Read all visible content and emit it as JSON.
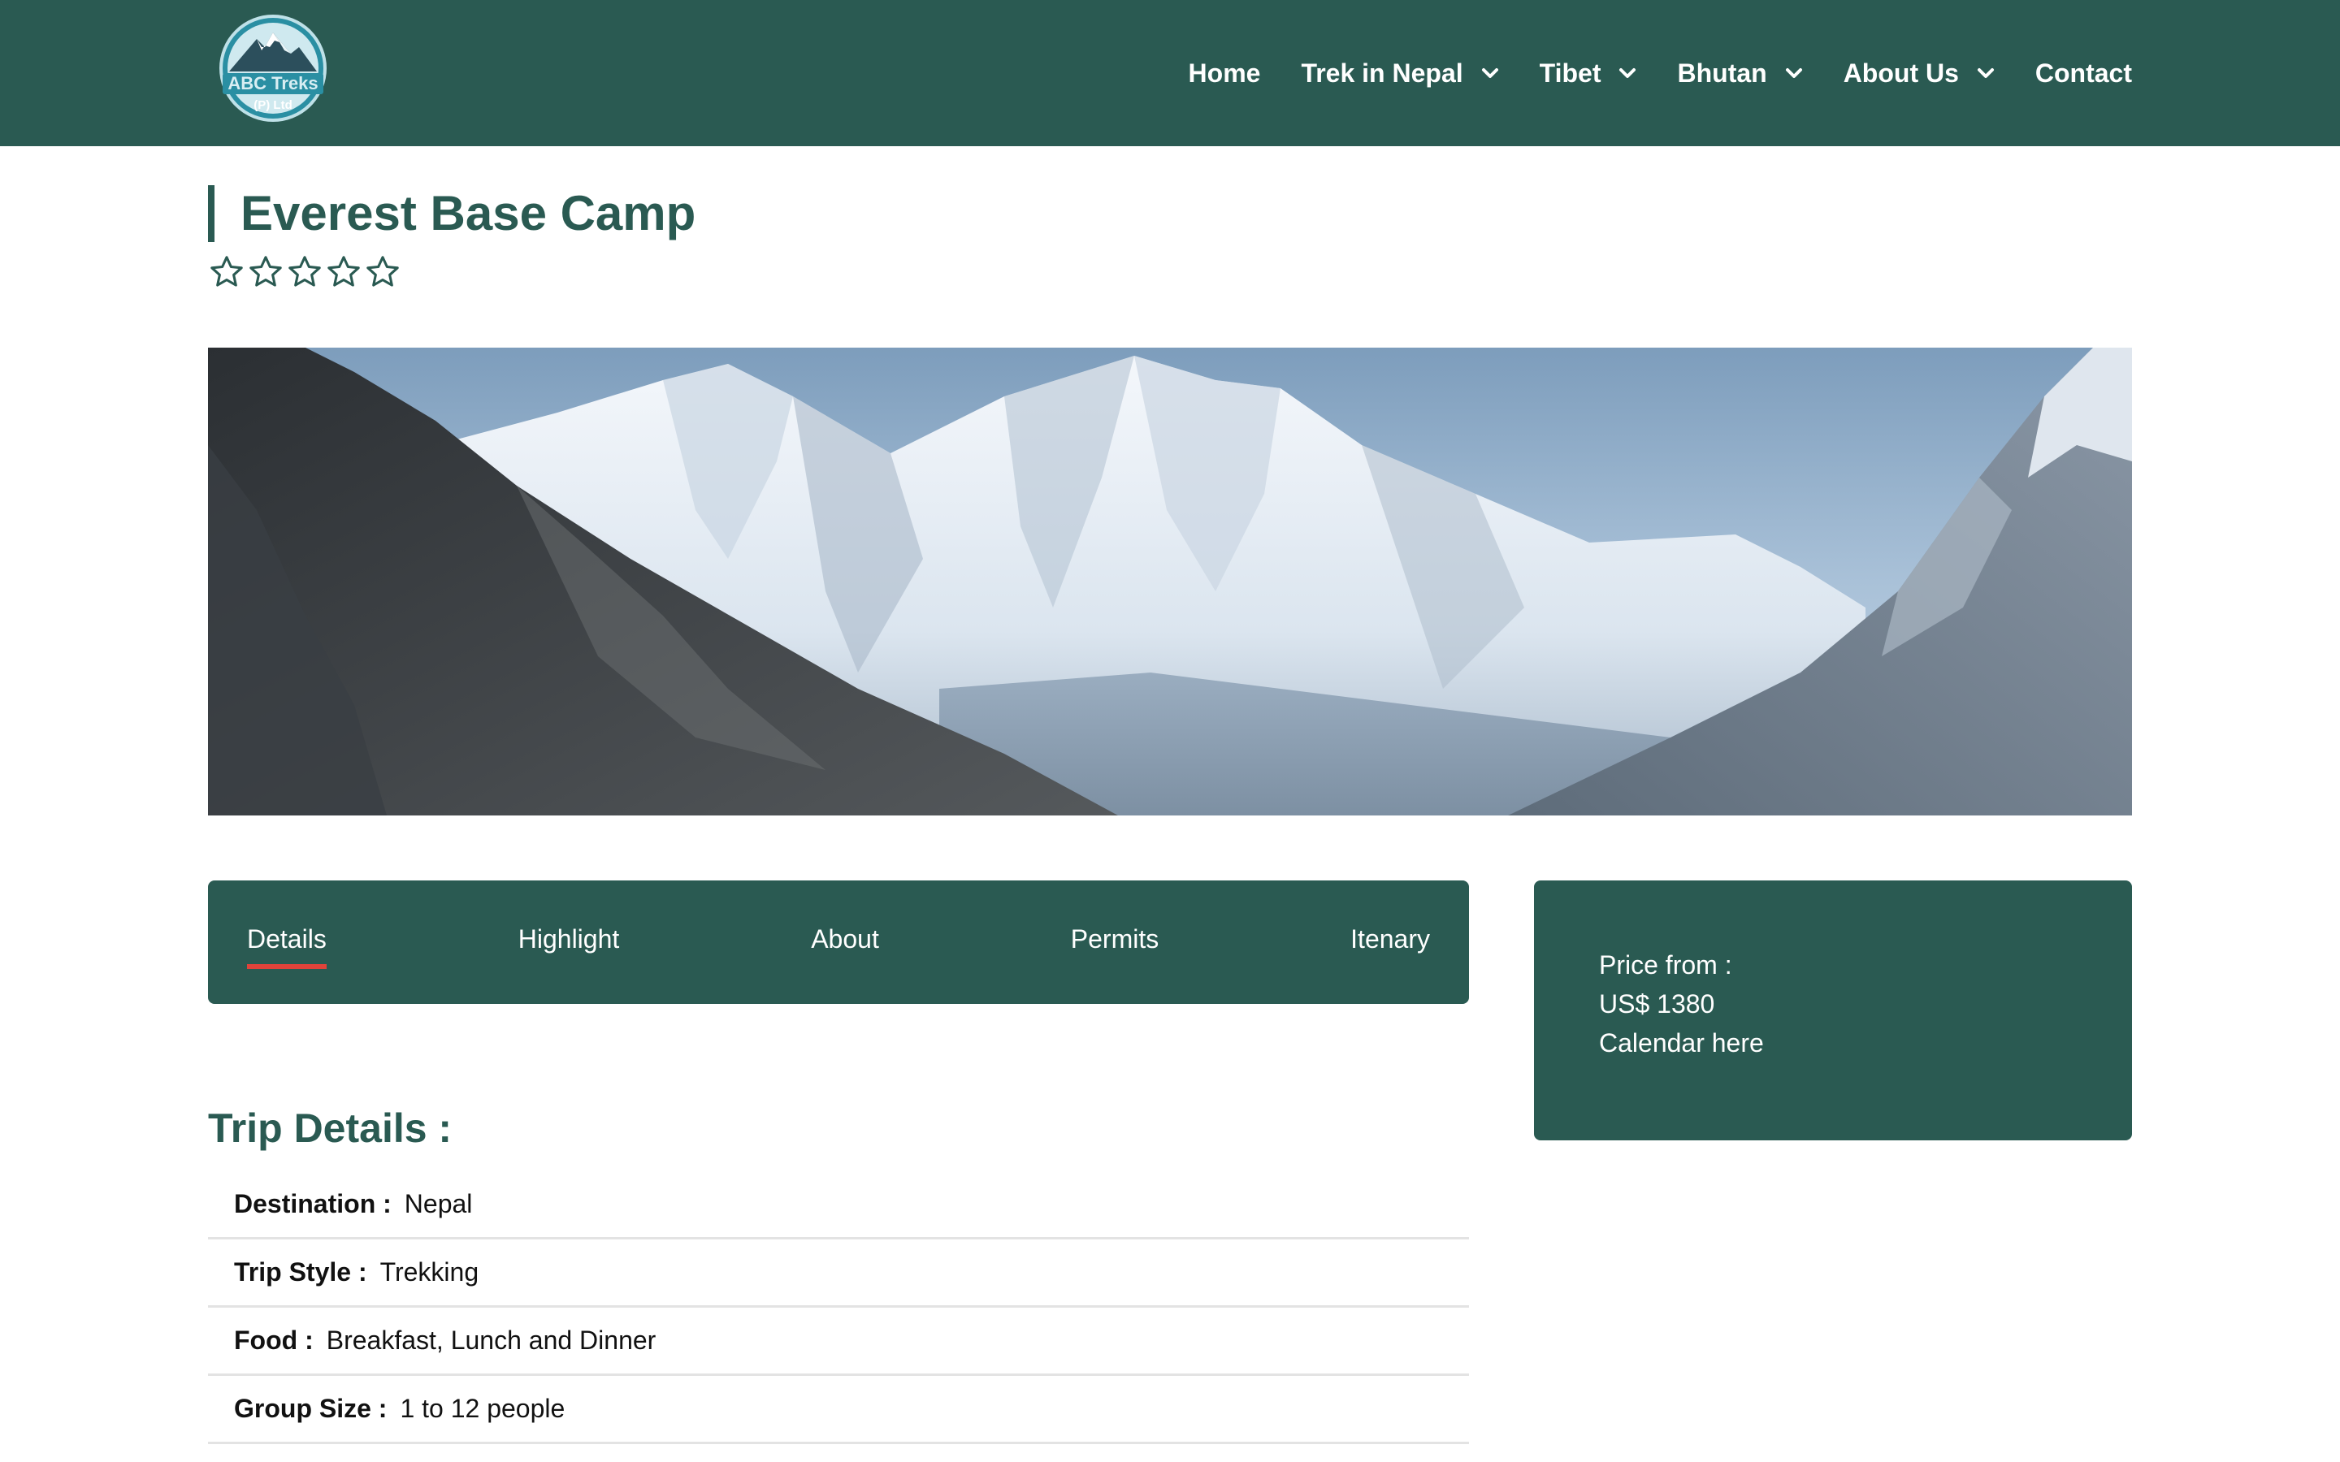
{
  "header": {
    "logo_text": "ABC Treks",
    "logo_subtext": "(P) Ltd",
    "nav": [
      {
        "label": "Home",
        "dropdown": false
      },
      {
        "label": "Trek in Nepal",
        "dropdown": true
      },
      {
        "label": "Tibet",
        "dropdown": true
      },
      {
        "label": "Bhutan",
        "dropdown": true
      },
      {
        "label": "About Us",
        "dropdown": true
      },
      {
        "label": "Contact",
        "dropdown": false
      }
    ]
  },
  "page": {
    "title": "Everest Base Camp",
    "rating": 0,
    "rating_max": 5
  },
  "tabs": {
    "items": [
      "Details",
      "Highlight",
      "About",
      "Permits",
      "Itenary"
    ],
    "active": "Details"
  },
  "price_card": {
    "price_label": "Price from :",
    "price_value": "US$ 1380",
    "calendar_text": "Calendar here"
  },
  "trip_details": {
    "heading": "Trip Details :",
    "rows": [
      {
        "label": "Destination :",
        "value": "Nepal"
      },
      {
        "label": "Trip Style :",
        "value": "Trekking"
      },
      {
        "label": "Food :",
        "value": "Breakfast, Lunch and Dinner"
      },
      {
        "label": "Group Size :",
        "value": "1 to 12 people"
      }
    ]
  },
  "colors": {
    "brand": "#2a5a52",
    "tab_underline": "#e0433a",
    "divider": "#e3e3e3"
  }
}
